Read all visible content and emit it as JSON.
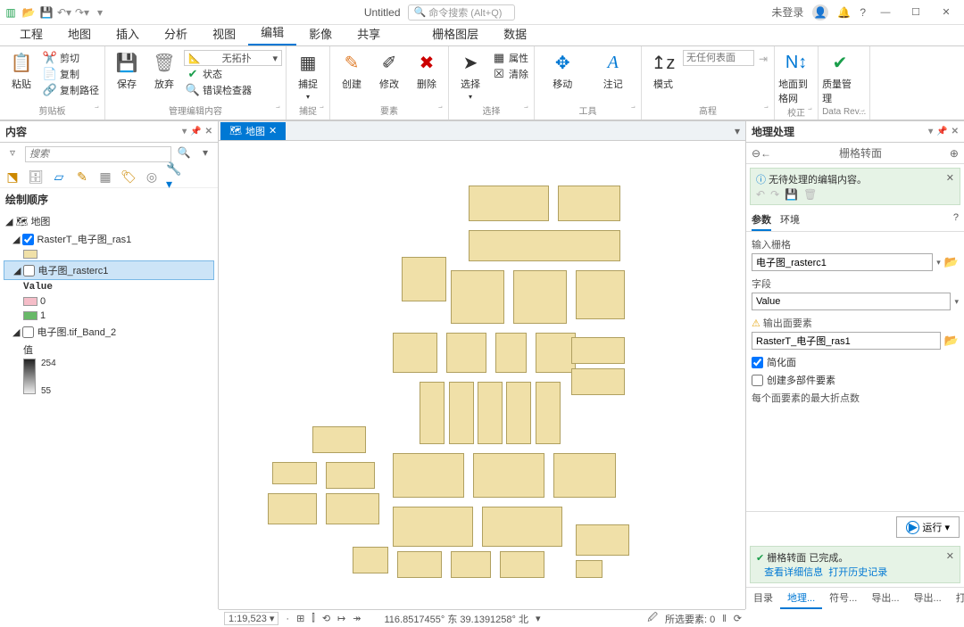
{
  "titlebar": {
    "doc_title": "Untitled",
    "search_placeholder": "命令搜索 (Alt+Q)",
    "not_logged_in": "未登录",
    "qat_icons": [
      "new-project",
      "open-project",
      "save-project",
      "undo",
      "redo"
    ]
  },
  "ribbon_tabs": [
    "工程",
    "地图",
    "插入",
    "分析",
    "视图",
    "编辑",
    "影像",
    "共享"
  ],
  "ribbon_context_tabs": [
    "栅格图层",
    "数据"
  ],
  "ribbon_groups": {
    "clipboard": {
      "label": "剪贴板",
      "paste": "粘贴",
      "cut": "剪切",
      "copy": "复制",
      "copy_path": "复制路径"
    },
    "manage": {
      "label": "管理编辑内容",
      "save": "保存",
      "discard": "放弃",
      "topology_dd": "无拓扑",
      "status": "状态",
      "error_inspector": "错误检查器"
    },
    "snapping": {
      "label": "捕捉",
      "snap": "捕捉"
    },
    "features": {
      "label": "要素",
      "create": "创建",
      "modify": "修改",
      "delete": "删除"
    },
    "selection": {
      "label": "选择",
      "select": "选择",
      "attributes": "属性",
      "clear": "清除"
    },
    "tools": {
      "label": "工具",
      "move": "移动",
      "annotation": "注记"
    },
    "elevation": {
      "label": "高程",
      "mode": "模式",
      "no_surface": "无任何表面"
    },
    "correction": {
      "label": "校正",
      "ground_to_grid": "地面到格网"
    },
    "datarev": {
      "label": "Data Rev...",
      "quality": "质量管理"
    }
  },
  "contents": {
    "title": "内容",
    "search_placeholder": "搜索",
    "section": "绘制顺序",
    "map_node": "地图",
    "layers": [
      {
        "name": "RasterT_电子图_ras1",
        "checked": true,
        "swatch": "#f0e0a8"
      },
      {
        "name": "电子图_rasterc1",
        "checked": false,
        "selected": true,
        "value_label": "Value",
        "classes": [
          {
            "v": "0",
            "c": "#f5bdc8"
          },
          {
            "v": "1",
            "c": "#68b968"
          }
        ]
      },
      {
        "name": "电子图.tif_Band_2",
        "checked": false,
        "value_label": "值",
        "range": [
          "254",
          "55"
        ]
      }
    ]
  },
  "map": {
    "tab_label": "地图"
  },
  "geoprocessing": {
    "panel_title": "地理处理",
    "tool_title": "栅格转面",
    "pending_msg": "无待处理的编辑内容。",
    "tabs": [
      "参数",
      "环境"
    ],
    "fields": {
      "input_raster": {
        "label": "输入栅格",
        "value": "电子图_rasterc1"
      },
      "field": {
        "label": "字段",
        "value": "Value"
      },
      "output": {
        "label": "输出面要素",
        "value": "RasterT_电子图_ras1",
        "warn": true
      },
      "simplify": {
        "label": "简化面",
        "checked": true
      },
      "multipart": {
        "label": "创建多部件要素",
        "checked": false
      },
      "max_vertices": {
        "label": "每个面要素的最大折点数"
      }
    },
    "run": "运行",
    "status": {
      "title": "栅格转面 已完成。",
      "detail": "查看详细信息",
      "history": "打开历史记录"
    },
    "bottom_tabs": [
      "目录",
      "地理...",
      "符号...",
      "导出...",
      "导出...",
      "打印..."
    ]
  },
  "statusbar": {
    "scale": "1:19,523",
    "coords": "116.8517455° 东 39.1391258° 北",
    "selected": "所选要素: 0"
  }
}
